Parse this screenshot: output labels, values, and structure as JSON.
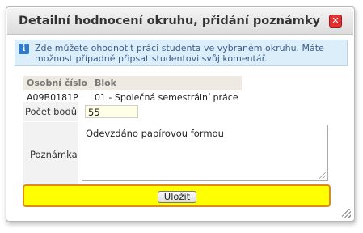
{
  "dialog": {
    "title": "Detailní hodnocení okruhu, přidání poznámky",
    "close_symbol": "✕",
    "close_icon": "close-icon"
  },
  "info": {
    "icon": "info-icon",
    "icon_glyph": "i",
    "text": "Zde můžete ohodnotit práci studenta ve vybraném okruhu. Máte možnost případně připsat studentovi svůj komentář."
  },
  "block_table": {
    "headers": [
      "Osobní číslo",
      "Blok"
    ],
    "rows": [
      [
        "A09B0181P",
        "01 - Společná semestrální práce"
      ]
    ]
  },
  "form": {
    "points_label": "Počet bodů",
    "points_value": "55",
    "note_label": "Poznámka",
    "note_value": "Odevzdáno papírovou formou"
  },
  "actions": {
    "save_label": "Uložit"
  },
  "colors": {
    "save_bar": "#ffff00",
    "save_bar_border": "#e08a1c",
    "info_bg": "#ddeefb",
    "close_button": "#e03030"
  }
}
